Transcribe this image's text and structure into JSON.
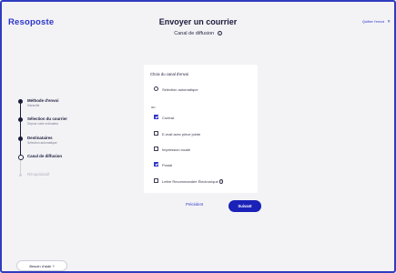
{
  "app": {
    "logo": "Resoposte"
  },
  "header": {
    "title": "Envoyer un courrier",
    "subtitle": "Canal de diffusion",
    "quit_label": "Quitter l'envoi",
    "quit_icon": "close-icon"
  },
  "stepper": {
    "steps": [
      {
        "label": "Méthode d'envoi",
        "sub": "Manuelle",
        "state": "done"
      },
      {
        "label": "Sélection du courrier",
        "sub": "Depuis votre ordinateur",
        "state": "done"
      },
      {
        "label": "Destinataires",
        "sub": "Sélection automatique",
        "state": "done"
      },
      {
        "label": "Canal de diffusion",
        "sub": "",
        "state": "current"
      },
      {
        "label": "Récapitulatif",
        "sub": "",
        "state": "future"
      }
    ]
  },
  "card": {
    "title": "Choix du canal d'envoi",
    "auto_option": "Sélection automatique",
    "or_text": "ou",
    "options": [
      {
        "label": "Contrat",
        "checked": true
      },
      {
        "label": "E-mail avec pièce jointe",
        "checked": false
      },
      {
        "label": "Impression locale",
        "checked": false
      },
      {
        "label": "Postal",
        "checked": true
      },
      {
        "label": "Lettre Recommandée Électronique",
        "checked": false
      }
    ]
  },
  "actions": {
    "prev_label": "Précédent",
    "next_label": "Suivant"
  },
  "help": {
    "label": "Besoin d'aide ?"
  },
  "colors": {
    "accent": "#2d36c8",
    "primary_button": "#1a21b8",
    "background": "#f3f3f6"
  }
}
